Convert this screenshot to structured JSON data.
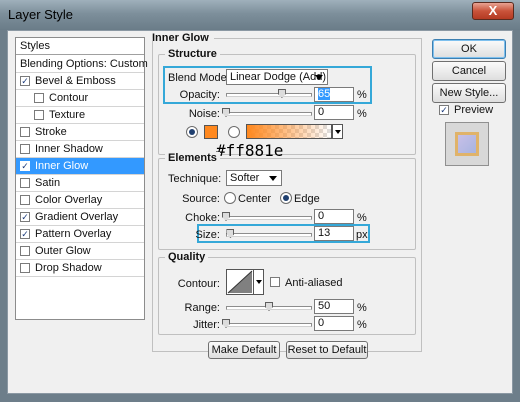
{
  "window": {
    "title": "Layer Style",
    "close_glyph": "X"
  },
  "styles_panel": {
    "header": "Styles",
    "items": [
      {
        "label": "Blending Options: Custom",
        "checkbox": false,
        "checked": false,
        "indent": 0,
        "selected": false
      },
      {
        "label": "Bevel & Emboss",
        "checkbox": true,
        "checked": true,
        "indent": 0,
        "selected": false
      },
      {
        "label": "Contour",
        "checkbox": true,
        "checked": false,
        "indent": 1,
        "selected": false
      },
      {
        "label": "Texture",
        "checkbox": true,
        "checked": false,
        "indent": 1,
        "selected": false
      },
      {
        "label": "Stroke",
        "checkbox": true,
        "checked": false,
        "indent": 0,
        "selected": false
      },
      {
        "label": "Inner Shadow",
        "checkbox": true,
        "checked": false,
        "indent": 0,
        "selected": false
      },
      {
        "label": "Inner Glow",
        "checkbox": true,
        "checked": true,
        "indent": 0,
        "selected": true
      },
      {
        "label": "Satin",
        "checkbox": true,
        "checked": false,
        "indent": 0,
        "selected": false
      },
      {
        "label": "Color Overlay",
        "checkbox": true,
        "checked": false,
        "indent": 0,
        "selected": false
      },
      {
        "label": "Gradient Overlay",
        "checkbox": true,
        "checked": true,
        "indent": 0,
        "selected": false
      },
      {
        "label": "Pattern Overlay",
        "checkbox": true,
        "checked": true,
        "indent": 0,
        "selected": false
      },
      {
        "label": "Outer Glow",
        "checkbox": true,
        "checked": false,
        "indent": 0,
        "selected": false
      },
      {
        "label": "Drop Shadow",
        "checkbox": true,
        "checked": false,
        "indent": 0,
        "selected": false
      }
    ]
  },
  "inner_glow": {
    "header": "Inner Glow",
    "structure": {
      "title": "Structure",
      "blend_mode_label": "Blend Mode:",
      "blend_mode_value": "Linear Dodge (Add)",
      "opacity_label": "Opacity:",
      "opacity_value": "65",
      "opacity_unit": "%",
      "opacity_level": 0.65,
      "noise_label": "Noise:",
      "noise_value": "0",
      "noise_unit": "%",
      "noise_level": 0,
      "glow_color": "#ff881e"
    },
    "annotation": "#ff881e",
    "elements": {
      "title": "Elements",
      "technique_label": "Technique:",
      "technique_value": "Softer",
      "source_label": "Source:",
      "source_center": "Center",
      "source_edge": "Edge",
      "source_selected": "Edge",
      "choke_label": "Choke:",
      "choke_value": "0",
      "choke_unit": "%",
      "choke_level": 0,
      "size_label": "Size:",
      "size_value": "13",
      "size_unit": "px",
      "size_level": 0.052
    },
    "quality": {
      "title": "Quality",
      "contour_label": "Contour:",
      "anti_aliased_label": "Anti-aliased",
      "anti_aliased_checked": false,
      "range_label": "Range:",
      "range_value": "50",
      "range_unit": "%",
      "range_level": 0.5,
      "jitter_label": "Jitter:",
      "jitter_value": "0",
      "jitter_unit": "%",
      "jitter_level": 0
    },
    "make_default_label": "Make Default",
    "reset_default_label": "Reset to Default"
  },
  "actions": {
    "ok_label": "OK",
    "cancel_label": "Cancel",
    "new_style_label": "New Style...",
    "preview_label": "Preview",
    "preview_checked": true
  },
  "colors": {
    "accent": "#3399ff",
    "highlight_box": "#35a8d8",
    "glow": "#ff881e"
  }
}
